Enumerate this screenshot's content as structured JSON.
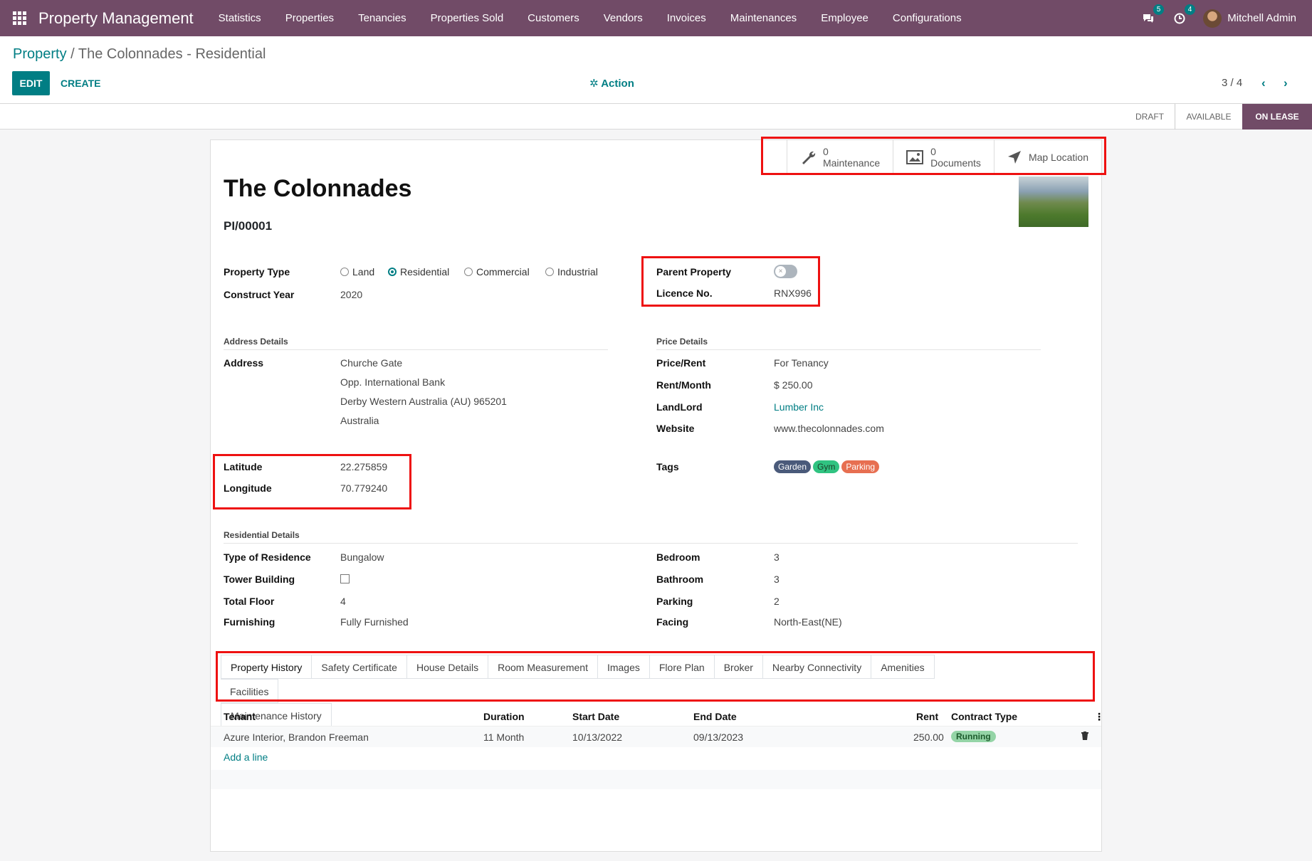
{
  "nav": {
    "brand": "Property Management",
    "menu": [
      "Statistics",
      "Properties",
      "Tenancies",
      "Properties Sold",
      "Customers",
      "Vendors",
      "Invoices",
      "Maintenances",
      "Employee",
      "Configurations"
    ],
    "messages_count": "5",
    "activities_count": "4",
    "user_name": "Mitchell Admin"
  },
  "breadcrumb": {
    "parent": "Property",
    "separator": " / ",
    "current": "The Colonnades - Residential"
  },
  "toolbar": {
    "edit": "EDIT",
    "create": "CREATE",
    "action": "Action",
    "pager": "3 / 4"
  },
  "status": {
    "draft": "DRAFT",
    "available": "AVAILABLE",
    "on_lease": "ON LEASE"
  },
  "smart_buttons": {
    "maintenance_count": "0",
    "maintenance_label": "Maintenance",
    "documents_count": "0",
    "documents_label": "Documents",
    "map_label": "Map Location"
  },
  "record": {
    "name": "The Colonnades",
    "reference": "PI/00001",
    "property_type_label": "Property Type",
    "property_types": [
      "Land",
      "Residential",
      "Commercial",
      "Industrial"
    ],
    "construct_year_label": "Construct Year",
    "construct_year": "2020",
    "parent_property_label": "Parent Property",
    "licence_label": "Licence No.",
    "licence": "RNX996"
  },
  "address": {
    "section": "Address Details",
    "label": "Address",
    "street": "Churche Gate",
    "street2": "Opp. International Bank",
    "city_line": "Derby  Western Australia (AU)  965201",
    "country": "Australia",
    "latitude_label": "Latitude",
    "latitude": "22.275859",
    "longitude_label": "Longitude",
    "longitude": "70.779240"
  },
  "price": {
    "section": "Price Details",
    "price_rent_label": "Price/Rent",
    "price_rent": "For Tenancy",
    "rent_month_label": "Rent/Month",
    "rent_month": "$ 250.00",
    "landlord_label": "LandLord",
    "landlord": "Lumber Inc",
    "website_label": "Website",
    "website": "www.thecolonnades.com",
    "tags_label": "Tags",
    "tags": [
      {
        "name": "Garden",
        "color": "#4a5a7a"
      },
      {
        "name": "Gym",
        "color": "#30c381"
      },
      {
        "name": "Parking",
        "color": "#e76f51"
      }
    ]
  },
  "residential": {
    "section": "Residential Details",
    "residence_type_label": "Type of Residence",
    "residence_type": "Bungalow",
    "tower_label": "Tower Building",
    "floor_label": "Total Floor",
    "floor": "4",
    "furnishing_label": "Furnishing",
    "furnishing": "Fully Furnished",
    "bedroom_label": "Bedroom",
    "bedroom": "3",
    "bathroom_label": "Bathroom",
    "bathroom": "3",
    "parking_label": "Parking",
    "parking": "2",
    "facing_label": "Facing",
    "facing": "North-East(NE)"
  },
  "tabs": [
    "Property History",
    "Safety Certificate",
    "House Details",
    "Room Measurement",
    "Images",
    "Flore Plan",
    "Broker",
    "Nearby Connectivity",
    "Amenities",
    "Facilities",
    "Maintenance History"
  ],
  "history": {
    "columns": [
      "Tenant",
      "Duration",
      "Start Date",
      "End Date",
      "Rent",
      "Contract Type"
    ],
    "rows": [
      {
        "tenant": "Azure Interior, Brandon Freeman",
        "duration": "11 Month",
        "start": "10/13/2022",
        "end": "09/13/2023",
        "rent": "250.00",
        "contract": "Running"
      }
    ],
    "add_line": "Add a line"
  },
  "colors": {
    "brand": "#714b67",
    "accent": "#017e84",
    "highlight": "#e11111"
  }
}
